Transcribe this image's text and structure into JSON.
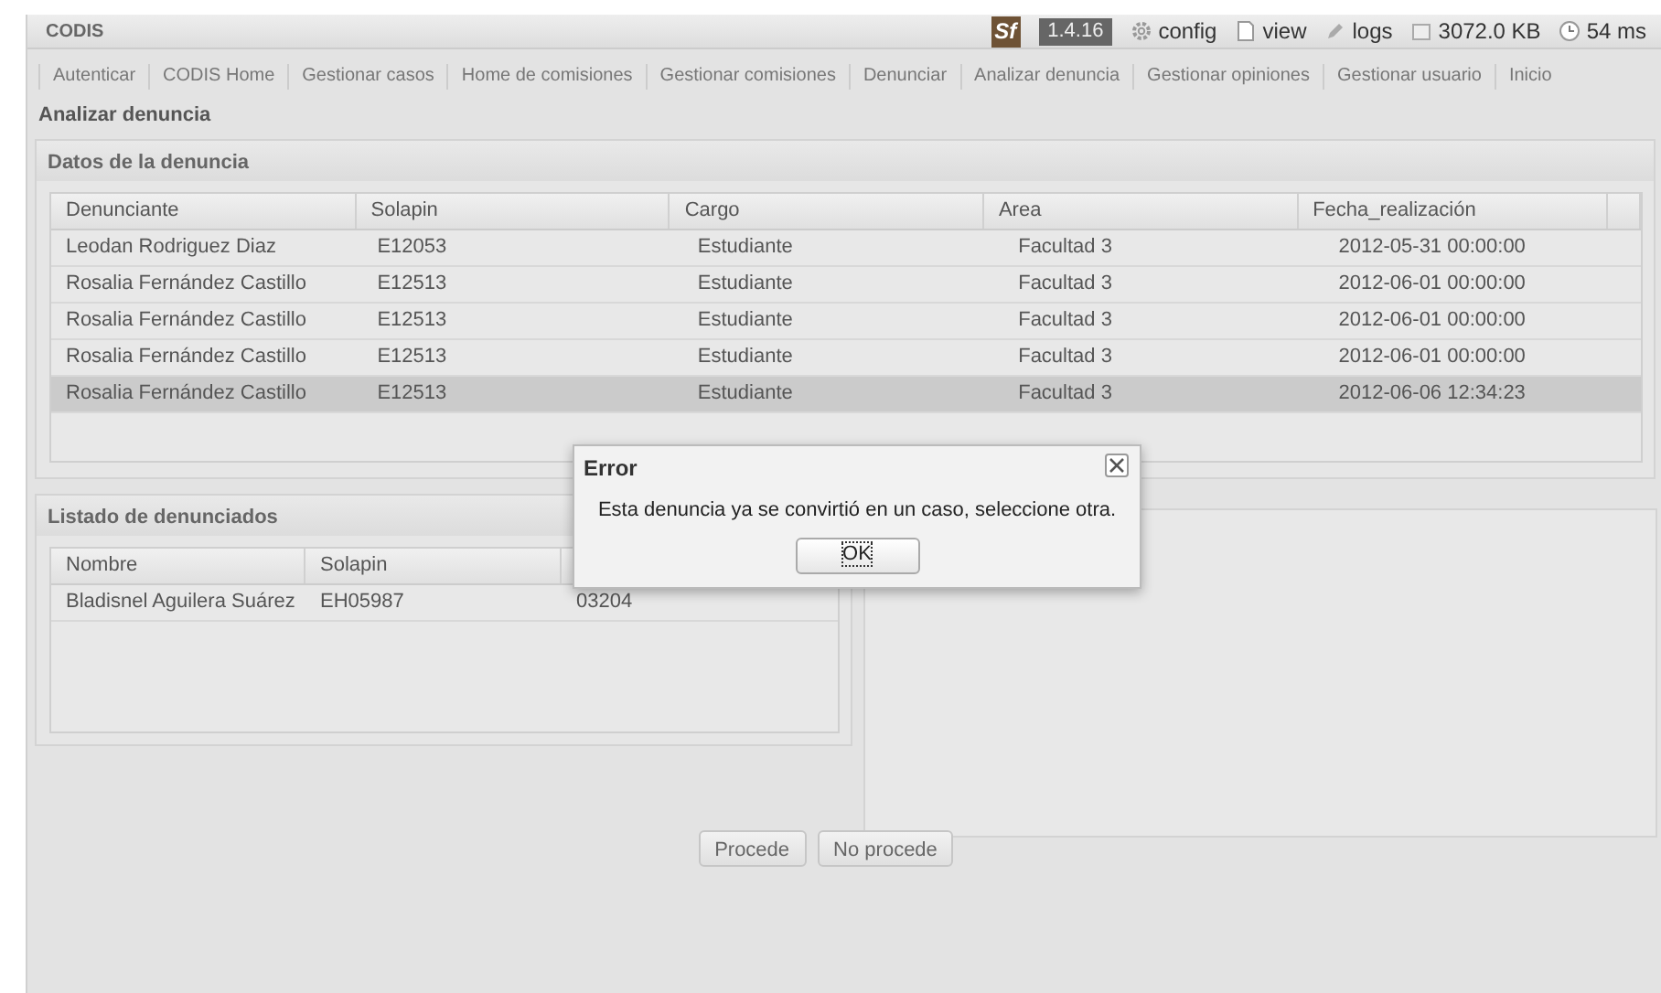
{
  "debug_bar": {
    "title": "CODIS",
    "logo": "Sf",
    "version": "1.4.16",
    "items": [
      {
        "kind": "config",
        "label": "config"
      },
      {
        "kind": "view",
        "label": "view"
      },
      {
        "kind": "logs",
        "label": "logs"
      },
      {
        "kind": "memory",
        "label": "3072.0 KB"
      },
      {
        "kind": "time",
        "label": "54 ms"
      }
    ]
  },
  "nav": [
    "Autenticar",
    "CODIS Home",
    "Gestionar casos",
    "Home de comisiones",
    "Gestionar comisiones",
    "Denunciar",
    "Analizar denuncia",
    "Gestionar opiniones",
    "Gestionar usuario",
    "Inicio"
  ],
  "page_title": "Analizar denuncia",
  "denuncia_panel": {
    "title": "Datos de la denuncia",
    "columns": [
      "Denunciante",
      "Solapin",
      "Cargo",
      "Area",
      "Fecha_realización"
    ],
    "rows": [
      {
        "cells": [
          "Leodan Rodriguez Diaz",
          "E12053",
          "Estudiante",
          "Facultad 3",
          "2012-05-31 00:00:00"
        ],
        "selected": false
      },
      {
        "cells": [
          "Rosalia Fernández Castillo",
          "E12513",
          "Estudiante",
          "Facultad 3",
          "2012-06-01 00:00:00"
        ],
        "selected": false
      },
      {
        "cells": [
          "Rosalia Fernández Castillo",
          "E12513",
          "Estudiante",
          "Facultad 3",
          "2012-06-01 00:00:00"
        ],
        "selected": false
      },
      {
        "cells": [
          "Rosalia Fernández Castillo",
          "E12513",
          "Estudiante",
          "Facultad 3",
          "2012-06-01 00:00:00"
        ],
        "selected": false
      },
      {
        "cells": [
          "Rosalia Fernández Castillo",
          "E12513",
          "Estudiante",
          "Facultad 3",
          "2012-06-06 12:34:23"
        ],
        "selected": true
      }
    ]
  },
  "denunciados_panel": {
    "title": "Listado de denunciados",
    "columns": [
      "Nombre",
      "Solapin"
    ],
    "rows": [
      {
        "cells": [
          "Bladisnel Aguilera Suárez",
          "EH05987",
          "03204"
        ],
        "selected": false
      }
    ]
  },
  "buttons": [
    "Procede",
    "No procede"
  ],
  "dialog": {
    "title": "Error",
    "message": "Esta denuncia ya se convirtió en un caso, seleccione otra.",
    "button": "OK"
  }
}
